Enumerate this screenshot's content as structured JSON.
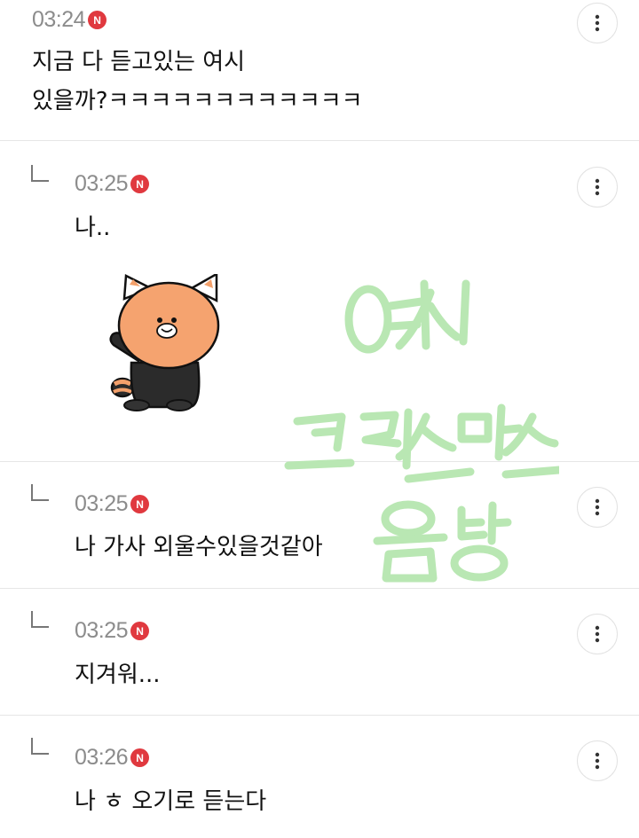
{
  "comments": [
    {
      "time": "03:24",
      "badge": "N",
      "lines": [
        "지금 다 듣고있는 여시",
        "있을까?ㅋㅋㅋㅋㅋㅋㅋㅋㅋㅋㅋㅋ"
      ],
      "is_reply": false
    },
    {
      "time": "03:25",
      "badge": "N",
      "lines": [
        "나.."
      ],
      "is_reply": true,
      "sticker": "raccoon-cat-waving-sticker"
    },
    {
      "time": "03:25",
      "badge": "N",
      "lines": [
        "나 가사 외울수있을것같아"
      ],
      "is_reply": true
    },
    {
      "time": "03:25",
      "badge": "N",
      "lines": [
        "지겨워..."
      ],
      "is_reply": true
    },
    {
      "time": "03:26",
      "badge": "N",
      "lines": [
        "나 ㅎ 오기로 듣는다"
      ],
      "is_reply": true
    }
  ],
  "watermark": {
    "text": [
      "여시",
      "크리스마스",
      "음방"
    ],
    "color": "#b9e7b3"
  },
  "icons": {
    "more": "more-vertical-icon",
    "reply": "reply-arrow-icon",
    "new": "new-badge-icon"
  }
}
